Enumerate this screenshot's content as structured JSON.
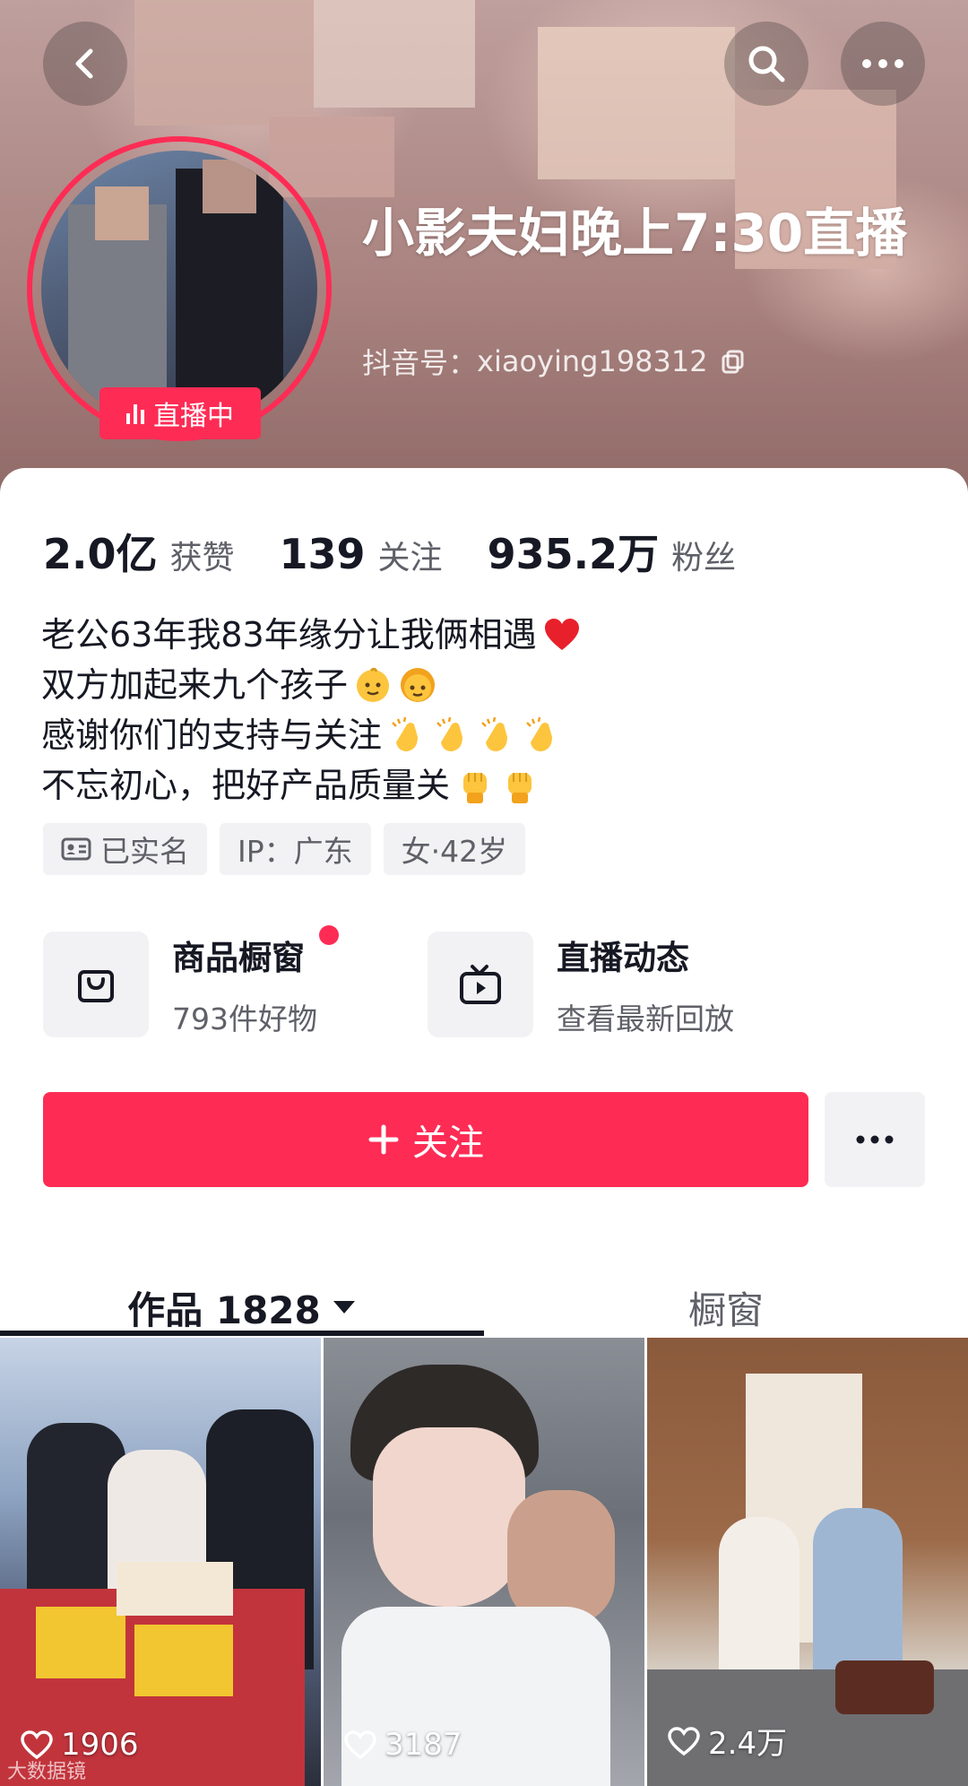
{
  "header": {
    "nickname": "小影夫妇晚上7:30直播",
    "douyin_id_label": "抖音号：",
    "douyin_id": "xiaoying198312",
    "live_badge": "直播中",
    "icons": [
      "back-icon",
      "search-icon",
      "more-icon",
      "copy-icon"
    ]
  },
  "stats": [
    {
      "value": "2.0亿",
      "label": "获赞"
    },
    {
      "value": "139",
      "label": "关注"
    },
    {
      "value": "935.2万",
      "label": "粉丝"
    }
  ],
  "bio": {
    "line1": "老公63年我83年缘分让我俩相遇",
    "line2": "双方加起来九个孩子",
    "line3": "感谢你们的支持与关注",
    "line4": "不忘初心，把好产品质量关"
  },
  "tags": {
    "verified": "已实名",
    "ip": "IP：广东",
    "gender_age": "女·42岁"
  },
  "entries": {
    "shop_title": "商品橱窗",
    "shop_sub": "793件好物",
    "live_title": "直播动态",
    "live_sub": "查看最新回放"
  },
  "actions": {
    "follow": "关注"
  },
  "tabs": {
    "works_label": "作品 1828",
    "shop_label": "橱窗"
  },
  "videos": [
    {
      "likes": "1906"
    },
    {
      "likes": "3187"
    },
    {
      "likes": "2.4万"
    }
  ],
  "watermark": "大数据镜",
  "colors": {
    "accent": "#fe2c55",
    "text": "#161823",
    "muted": "#5f6068",
    "chip": "#f2f2f4"
  }
}
